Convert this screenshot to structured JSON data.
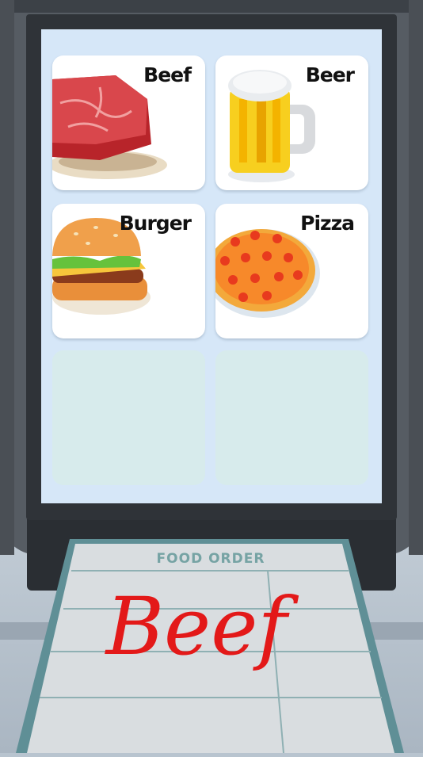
{
  "menu": {
    "items": [
      {
        "label": "Beef",
        "icon": "beef-steak-icon"
      },
      {
        "label": "Beer",
        "icon": "beer-mug-icon"
      },
      {
        "label": "Burger",
        "icon": "burger-icon"
      },
      {
        "label": "Pizza",
        "icon": "pizza-icon"
      }
    ],
    "empty_slots": 2
  },
  "order_ticket": {
    "heading": "FOOD ORDER",
    "written_order": "Beef",
    "ink_color": "#e31919"
  }
}
